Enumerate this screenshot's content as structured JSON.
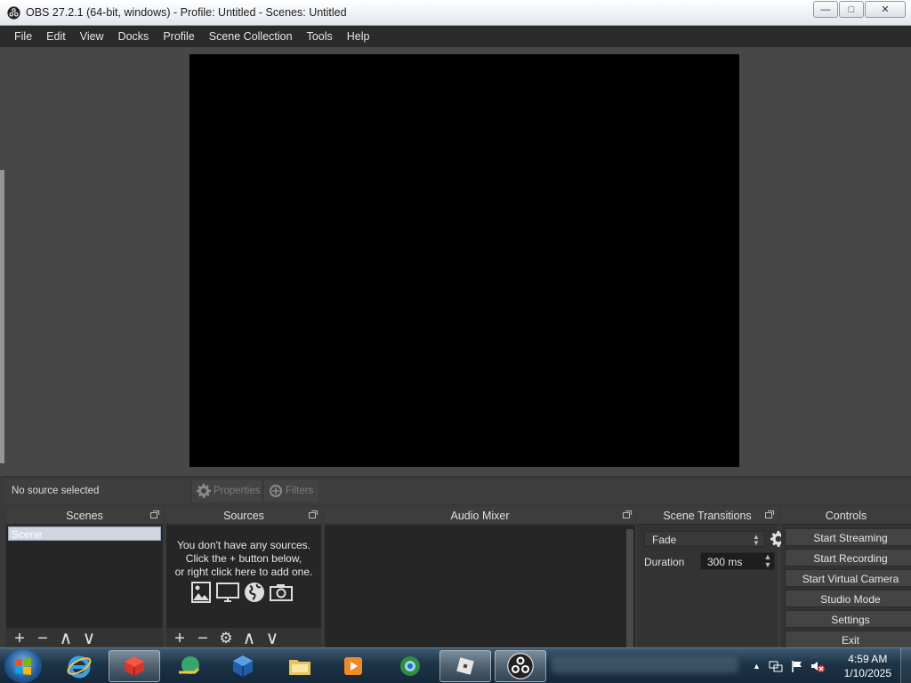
{
  "window": {
    "title": "OBS 27.2.1 (64-bit, windows) - Profile: Untitled - Scenes: Untitled",
    "controls": {
      "minimize": "—",
      "maximize": "□",
      "close": "✕"
    }
  },
  "menu": [
    "File",
    "Edit",
    "View",
    "Docks",
    "Profile",
    "Scene Collection",
    "Tools",
    "Help"
  ],
  "context_bar": {
    "status": "No source selected",
    "properties_label": "Properties",
    "filters_label": "Filters"
  },
  "docks": {
    "scenes": {
      "title": "Scenes",
      "items": [
        "Scene"
      ],
      "tools": [
        "+",
        "−",
        "∧",
        "∨"
      ]
    },
    "sources": {
      "title": "Sources",
      "empty_line1": "You don't have any sources.",
      "empty_line2": "Click the + button below,",
      "empty_line3": "or right click here to add one.",
      "tools": [
        "+",
        "−",
        "⚙",
        "∧",
        "∨"
      ]
    },
    "mixer": {
      "title": "Audio Mixer"
    },
    "transitions": {
      "title": "Scene Transitions",
      "selected": "Fade",
      "duration_label": "Duration",
      "duration_value": "300 ms"
    },
    "controls": {
      "title": "Controls",
      "buttons": [
        "Start Streaming",
        "Start Recording",
        "Start Virtual Camera",
        "Studio Mode",
        "Settings",
        "Exit"
      ]
    }
  },
  "taskbar": {
    "time": "4:59 AM",
    "date": "1/10/2025",
    "tray_arrow": "▲"
  }
}
